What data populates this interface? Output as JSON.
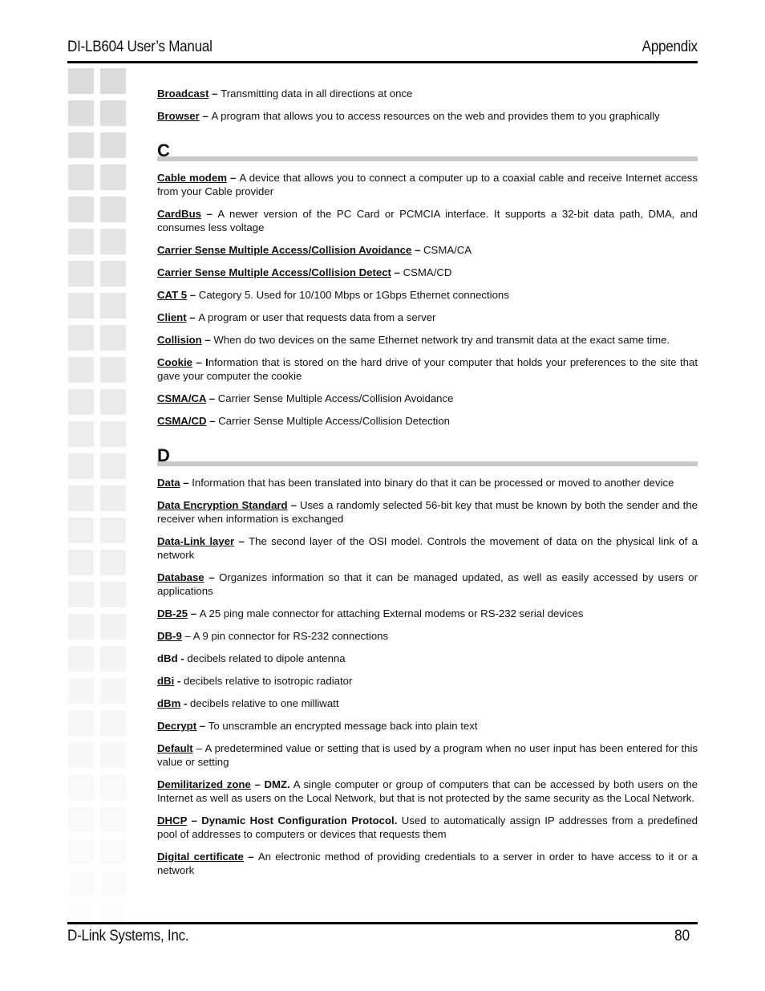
{
  "header": {
    "title": "DI-LB604 User’s Manual",
    "section": "Appendix"
  },
  "footer": {
    "company": "D-Link Systems, Inc.",
    "page_number": "80"
  },
  "glossary": {
    "intro_entries": [
      {
        "term": "Broadcast",
        "sep": " – ",
        "definition": "Transmitting data in all directions at once"
      },
      {
        "term": "Browser",
        "sep": " – ",
        "definition": "A program that allows you to access resources on the web and provides them to you graphically"
      }
    ],
    "sections": [
      {
        "letter": "C",
        "entries": [
          {
            "term": "Cable modem",
            "sep": " – ",
            "definition": "A device that allows you to connect a computer up to a coaxial cable and receive Internet access from your Cable provider"
          },
          {
            "term": "CardBus",
            "sep": " – ",
            "definition": "A newer version of the PC Card or PCMCIA interface.  It supports a 32-bit data path, DMA, and consumes less voltage"
          },
          {
            "term": "Carrier Sense Multiple Access/Collision Avoidance",
            "sep": " – ",
            "definition": "CSMA/CA"
          },
          {
            "term": "Carrier Sense Multiple Access/Collision Detect",
            "sep": " – ",
            "definition": "CSMA/CD"
          },
          {
            "term": "CAT 5",
            "sep": " – ",
            "definition": "Category 5. Used for 10/100 Mbps or 1Gbps Ethernet connections"
          },
          {
            "term": "Client",
            "sep": " – ",
            "definition": "A program or user that requests data from a server"
          },
          {
            "term": "Collision",
            "sep": " – ",
            "definition": "When do two devices on the same Ethernet network try and transmit data at the exact same time."
          },
          {
            "term": "Cookie",
            "sep": " – I",
            "definition": "nformation that is stored on the hard drive of your computer that holds your preferences to the site that gave your computer the cookie"
          },
          {
            "term": "CSMA/CA",
            "sep": " – ",
            "definition": "Carrier Sense Multiple Access/Collision Avoidance"
          },
          {
            "term": "CSMA/CD",
            "sep": " – ",
            "definition": "Carrier Sense Multiple Access/Collision Detection"
          }
        ]
      },
      {
        "letter": "D",
        "entries": [
          {
            "term": "Data",
            "sep": " – ",
            "definition": "Information that has been translated into binary do that it can be processed or moved to another device"
          },
          {
            "term": "Data Encryption Standard",
            "sep": " – ",
            "definition": "Uses a randomly selected 56-bit key that must be known by both the sender and the receiver when information is exchanged"
          },
          {
            "term": "Data-Link layer",
            "sep": " – ",
            "definition": "The second layer of the OSI model.  Controls the movement of data on the physical link of a network"
          },
          {
            "term": "Database",
            "sep": " – ",
            "definition": "Organizes information so that it can be managed updated, as well as easily accessed by users or applications"
          },
          {
            "term": "DB-25",
            "sep": " – ",
            "definition": "A 25 ping male connector for attaching External modems or RS-232 serial devices"
          },
          {
            "term": "DB-9",
            "sep": " – ",
            "definition": "A 9 pin connector for RS-232 connections"
          },
          {
            "term": "dBd",
            "sep": " - ",
            "definition": "decibels related to dipole antenna"
          },
          {
            "term": "dBi",
            "sep": " - ",
            "definition": "decibels relative to isotropic radiator"
          },
          {
            "term": "dBm",
            "sep": " - ",
            "definition": "decibels relative to one milliwatt"
          },
          {
            "term": "Decrypt",
            "sep": " – ",
            "definition": "To unscramble an encrypted message back into plain text"
          },
          {
            "term": "Default",
            "sep": " – ",
            "definition": "A predetermined value or setting that is used by a program when no user input has been entered for this value or setting"
          },
          {
            "term": "Demilitarized zone",
            "sep": " – DMZ.",
            "definition": "  A single computer or group of computers that can be accessed by both users on the Internet as well as users on the Local Network, but that is not protected by the same security as the Local Network."
          },
          {
            "term": "DHCP",
            "sep": " – Dynamic Host Configuration Protocol.",
            "definition": "  Used to automatically assign IP addresses from a predefined pool of addresses to computers or devices that requests them"
          },
          {
            "term": "Digital certificate",
            "sep": " – ",
            "definition": "An electronic method of providing credentials to a server in order to have access to it or a network"
          }
        ]
      }
    ]
  }
}
